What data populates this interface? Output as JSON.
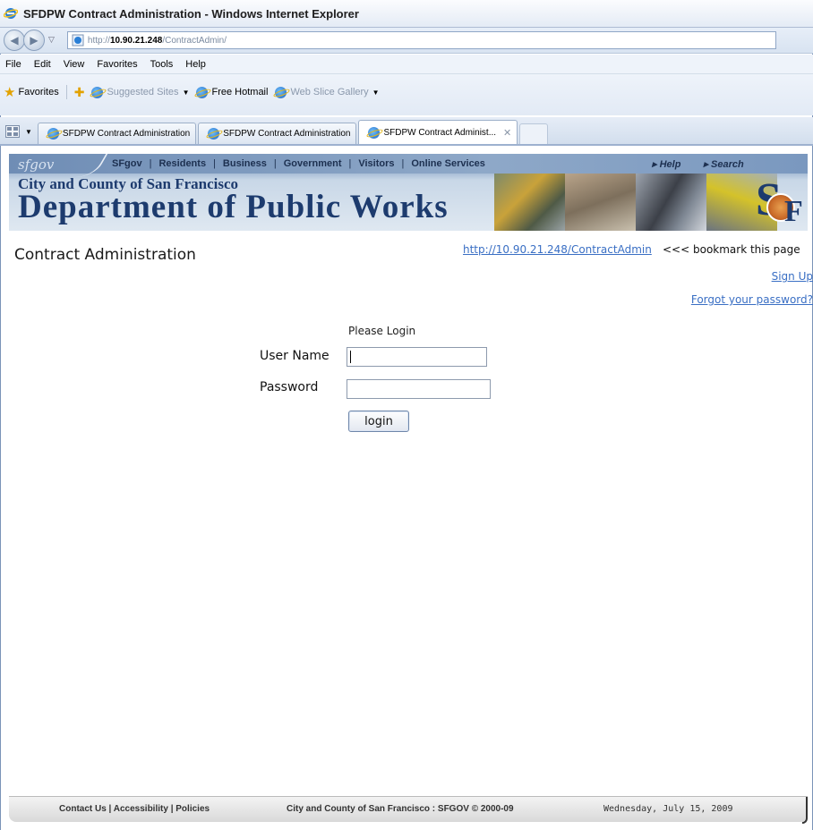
{
  "browser": {
    "title": "SFDPW Contract Administration - Windows Internet Explorer",
    "address": {
      "prefix": "http://",
      "host": "10.90.21.248",
      "path": "/ContractAdmin/"
    },
    "menu": [
      "File",
      "Edit",
      "View",
      "Favorites",
      "Tools",
      "Help"
    ],
    "favorites_bar": {
      "favorites": "Favorites",
      "suggested": "Suggested Sites",
      "hotmail": "Free Hotmail",
      "webslice": "Web Slice Gallery"
    },
    "tabs": [
      {
        "label": "SFDPW Contract Administration",
        "active": false
      },
      {
        "label": "SFDPW Contract Administration",
        "active": false
      },
      {
        "label": "SFDPW Contract Administ...",
        "active": true
      }
    ]
  },
  "banner": {
    "logo": "sfgov",
    "nav": [
      "SFgov",
      "Residents",
      "Business",
      "Government",
      "Visitors",
      "Online Services"
    ],
    "separator": "|",
    "help": "▸ Help",
    "search": "▸ Search",
    "city": "City and County of San Francisco",
    "department": "Department of Public Works"
  },
  "page": {
    "title": "Contract Administration",
    "bookmark_url": "http://10.90.21.248/ContractAdmin",
    "bookmark_note": "<<< bookmark this page",
    "signup": "Sign Up",
    "forgot": "Forgot your password?"
  },
  "login": {
    "heading": "Please Login",
    "username_label": "User Name",
    "password_label": "Password",
    "username_value": "",
    "password_value": "",
    "button": "login"
  },
  "footer": {
    "links": "Contact Us | Accessibility | Policies",
    "copyright": "City and County of San Francisco : SFGOV © 2000-09",
    "date": "Wednesday, July 15, 2009"
  }
}
